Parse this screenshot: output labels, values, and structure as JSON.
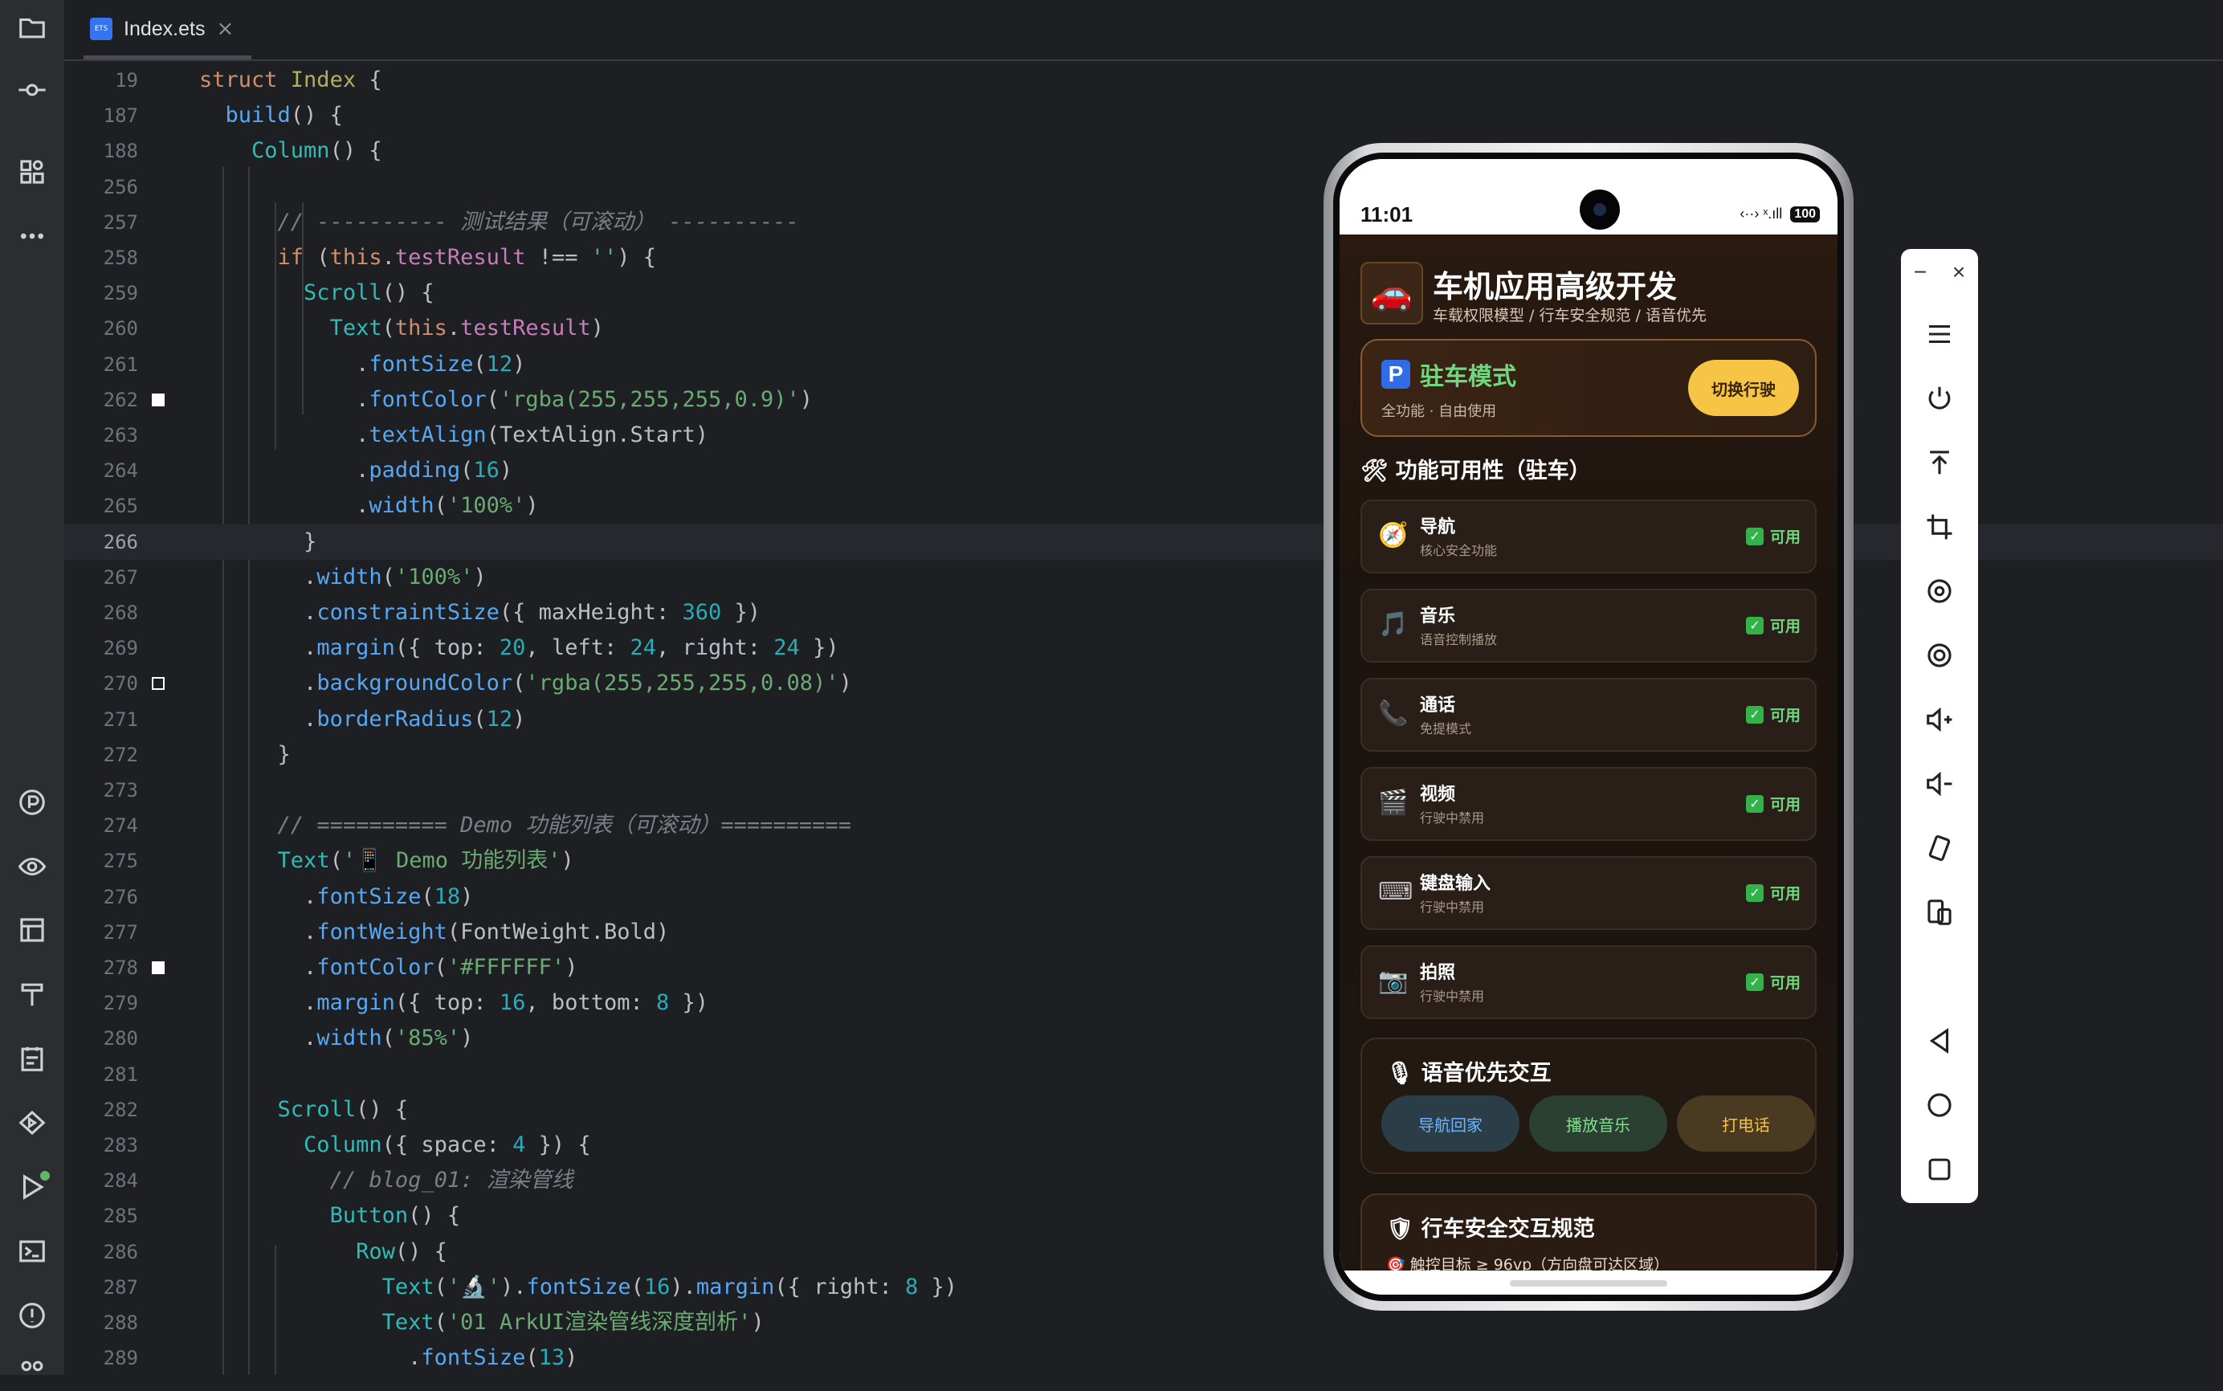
{
  "editor": {
    "tab": {
      "filename": "Index.ets",
      "icon": "ets-file-icon",
      "close": "×"
    },
    "lines": [
      {
        "n": "19",
        "tokens": [
          [
            "kw",
            "struct "
          ],
          [
            "type",
            "Index "
          ],
          [
            "",
            "{"
          ]
        ]
      },
      {
        "n": "187",
        "tokens": [
          [
            "",
            "  "
          ],
          [
            "fn",
            "build"
          ],
          [
            "",
            "() {"
          ]
        ]
      },
      {
        "n": "188",
        "tokens": [
          [
            "",
            "    "
          ],
          [
            "comp",
            "Column"
          ],
          [
            "",
            "() {"
          ]
        ]
      },
      {
        "n": "256",
        "tokens": []
      },
      {
        "n": "257",
        "tokens": [
          [
            "",
            "      "
          ],
          [
            "cmt",
            "// ---------- 测试结果（可滚动） ----------"
          ]
        ]
      },
      {
        "n": "258",
        "tokens": [
          [
            "",
            "      "
          ],
          [
            "kw",
            "if "
          ],
          [
            "",
            "("
          ],
          [
            "this",
            "this"
          ],
          [
            "",
            "."
          ],
          [
            "prop",
            "testResult"
          ],
          [
            "",
            " !== "
          ],
          [
            "str",
            "''"
          ],
          [
            "",
            ") {"
          ]
        ]
      },
      {
        "n": "259",
        "tokens": [
          [
            "",
            "        "
          ],
          [
            "comp",
            "Scroll"
          ],
          [
            "",
            "() {"
          ]
        ]
      },
      {
        "n": "260",
        "tokens": [
          [
            "",
            "          "
          ],
          [
            "comp",
            "Text"
          ],
          [
            "",
            "("
          ],
          [
            "this",
            "this"
          ],
          [
            "",
            "."
          ],
          [
            "prop",
            "testResult"
          ],
          [
            "",
            ")"
          ]
        ]
      },
      {
        "n": "261",
        "tokens": [
          [
            "",
            "            ."
          ],
          [
            "fn",
            "fontSize"
          ],
          [
            "",
            "("
          ],
          [
            "num",
            "12"
          ],
          [
            "",
            ")"
          ]
        ]
      },
      {
        "n": "262",
        "tokens": [
          [
            "",
            "            ."
          ],
          [
            "fn",
            "fontColor"
          ],
          [
            "",
            "("
          ],
          [
            "str",
            "'rgba(255,255,255,0.9)'"
          ],
          [
            "",
            ")"
          ]
        ]
      },
      {
        "n": "263",
        "tokens": [
          [
            "",
            "            ."
          ],
          [
            "fn",
            "textAlign"
          ],
          [
            "",
            "(TextAlign.Start)"
          ]
        ]
      },
      {
        "n": "264",
        "tokens": [
          [
            "",
            "            ."
          ],
          [
            "fn",
            "padding"
          ],
          [
            "",
            "("
          ],
          [
            "num",
            "16"
          ],
          [
            "",
            ")"
          ]
        ]
      },
      {
        "n": "265",
        "tokens": [
          [
            "",
            "            ."
          ],
          [
            "fn",
            "width"
          ],
          [
            "",
            "("
          ],
          [
            "str",
            "'100%'"
          ],
          [
            "",
            ")"
          ]
        ]
      },
      {
        "n": "266",
        "tokens": [
          [
            "",
            "        }"
          ]
        ]
      },
      {
        "n": "267",
        "tokens": [
          [
            "",
            "        ."
          ],
          [
            "fn",
            "width"
          ],
          [
            "",
            "("
          ],
          [
            "str",
            "'100%'"
          ],
          [
            "",
            ")"
          ]
        ]
      },
      {
        "n": "268",
        "tokens": [
          [
            "",
            "        ."
          ],
          [
            "fn",
            "constraintSize"
          ],
          [
            "",
            "({ maxHeight: "
          ],
          [
            "num",
            "360"
          ],
          [
            "",
            " })"
          ]
        ]
      },
      {
        "n": "269",
        "tokens": [
          [
            "",
            "        ."
          ],
          [
            "fn",
            "margin"
          ],
          [
            "",
            "({ top: "
          ],
          [
            "num",
            "20"
          ],
          [
            "",
            ", left: "
          ],
          [
            "num",
            "24"
          ],
          [
            "",
            ", right: "
          ],
          [
            "num",
            "24"
          ],
          [
            "",
            " })"
          ]
        ]
      },
      {
        "n": "270",
        "tokens": [
          [
            "",
            "        ."
          ],
          [
            "fn",
            "backgroundColor"
          ],
          [
            "",
            "("
          ],
          [
            "str",
            "'rgba(255,255,255,0.08)'"
          ],
          [
            "",
            ")"
          ]
        ]
      },
      {
        "n": "271",
        "tokens": [
          [
            "",
            "        ."
          ],
          [
            "fn",
            "borderRadius"
          ],
          [
            "",
            "("
          ],
          [
            "num",
            "12"
          ],
          [
            "",
            ")"
          ]
        ]
      },
      {
        "n": "272",
        "tokens": [
          [
            "",
            "      }"
          ]
        ]
      },
      {
        "n": "273",
        "tokens": []
      },
      {
        "n": "274",
        "tokens": [
          [
            "",
            "      "
          ],
          [
            "cmt",
            "// ========== Demo 功能列表（可滚动）=========="
          ]
        ]
      },
      {
        "n": "275",
        "tokens": [
          [
            "",
            "      "
          ],
          [
            "comp",
            "Text"
          ],
          [
            "",
            "("
          ],
          [
            "str",
            "'📱 Demo 功能列表'"
          ],
          [
            "",
            ")"
          ]
        ]
      },
      {
        "n": "276",
        "tokens": [
          [
            "",
            "        ."
          ],
          [
            "fn",
            "fontSize"
          ],
          [
            "",
            "("
          ],
          [
            "num",
            "18"
          ],
          [
            "",
            ")"
          ]
        ]
      },
      {
        "n": "277",
        "tokens": [
          [
            "",
            "        ."
          ],
          [
            "fn",
            "fontWeight"
          ],
          [
            "",
            "(FontWeight.Bold)"
          ]
        ]
      },
      {
        "n": "278",
        "tokens": [
          [
            "",
            "        ."
          ],
          [
            "fn",
            "fontColor"
          ],
          [
            "",
            "("
          ],
          [
            "str",
            "'#FFFFFF'"
          ],
          [
            "",
            ")"
          ]
        ]
      },
      {
        "n": "279",
        "tokens": [
          [
            "",
            "        ."
          ],
          [
            "fn",
            "margin"
          ],
          [
            "",
            "({ top: "
          ],
          [
            "num",
            "16"
          ],
          [
            "",
            ", bottom: "
          ],
          [
            "num",
            "8"
          ],
          [
            "",
            " })"
          ]
        ]
      },
      {
        "n": "280",
        "tokens": [
          [
            "",
            "        ."
          ],
          [
            "fn",
            "width"
          ],
          [
            "",
            "("
          ],
          [
            "str",
            "'85%'"
          ],
          [
            "",
            ")"
          ]
        ]
      },
      {
        "n": "281",
        "tokens": []
      },
      {
        "n": "282",
        "tokens": [
          [
            "",
            "      "
          ],
          [
            "comp",
            "Scroll"
          ],
          [
            "",
            "() {"
          ]
        ]
      },
      {
        "n": "283",
        "tokens": [
          [
            "",
            "        "
          ],
          [
            "comp",
            "Column"
          ],
          [
            "",
            "({ space: "
          ],
          [
            "num",
            "4"
          ],
          [
            "",
            " }) {"
          ]
        ]
      },
      {
        "n": "284",
        "tokens": [
          [
            "",
            "          "
          ],
          [
            "cmt",
            "// blog_01: 渲染管线"
          ]
        ]
      },
      {
        "n": "285",
        "tokens": [
          [
            "",
            "          "
          ],
          [
            "comp",
            "Button"
          ],
          [
            "",
            "() {"
          ]
        ]
      },
      {
        "n": "286",
        "tokens": [
          [
            "",
            "            "
          ],
          [
            "comp",
            "Row"
          ],
          [
            "",
            "() {"
          ]
        ]
      },
      {
        "n": "287",
        "tokens": [
          [
            "",
            "              "
          ],
          [
            "comp",
            "Text"
          ],
          [
            "",
            "("
          ],
          [
            "str",
            "'🔬'"
          ],
          [
            "",
            ")."
          ],
          [
            "fn",
            "fontSize"
          ],
          [
            "",
            "("
          ],
          [
            "num",
            "16"
          ],
          [
            "",
            ")."
          ],
          [
            "fn",
            "margin"
          ],
          [
            "",
            "({ right: "
          ],
          [
            "num",
            "8"
          ],
          [
            "",
            " })"
          ]
        ]
      },
      {
        "n": "288",
        "tokens": [
          [
            "",
            "              "
          ],
          [
            "comp",
            "Text"
          ],
          [
            "",
            "("
          ],
          [
            "str",
            "'01 ArkUI渲染管线深度剖析'"
          ],
          [
            "",
            ")"
          ]
        ]
      },
      {
        "n": "289",
        "tokens": [
          [
            "",
            "                ."
          ],
          [
            "fn",
            "fontSize"
          ],
          [
            "",
            "("
          ],
          [
            "num",
            "13"
          ],
          [
            "",
            ")"
          ]
        ]
      }
    ],
    "markers": {
      "262": "fill",
      "270": "outline",
      "278": "fill"
    },
    "current_line": "266"
  },
  "phone": {
    "status": {
      "time": "11:01",
      "signal": "‹··› ˣ.ıll",
      "battery": "100"
    },
    "app": {
      "badge_icon": "🚗",
      "title": "车机应用高级开发",
      "subtitle": "车载权限模型 / 行车安全规范 / 语音优先",
      "mode": {
        "badge": "P",
        "title": "驻车模式",
        "sub": "全功能 · 自由使用",
        "button": "切换行驶"
      },
      "features_heading": "🛠 功能可用性（驻车）",
      "features": [
        {
          "icon": "🧭",
          "name": "导航",
          "desc": "核心安全功能",
          "status": "可用"
        },
        {
          "icon": "🎵",
          "name": "音乐",
          "desc": "语音控制播放",
          "status": "可用"
        },
        {
          "icon": "📞",
          "name": "通话",
          "desc": "免提模式",
          "status": "可用"
        },
        {
          "icon": "🎬",
          "name": "视频",
          "desc": "行驶中禁用",
          "status": "可用"
        },
        {
          "icon": "⌨",
          "name": "键盘输入",
          "desc": "行驶中禁用",
          "status": "可用"
        },
        {
          "icon": "📷",
          "name": "拍照",
          "desc": "行驶中禁用",
          "status": "可用"
        }
      ],
      "voice": {
        "title": "🎙 语音优先交互",
        "buttons": [
          "导航回家",
          "播放音乐",
          "打电话"
        ]
      },
      "safety": {
        "title": "🛡 行车安全交互规范",
        "item": "🎯 触控目标 ≥ 96vp（方向盘可达区域）"
      }
    }
  },
  "emulator_tools": {
    "minimize": "−",
    "close": "×"
  },
  "colors": {
    "editor_bg": "#1e1f22",
    "accent_green": "#6fd87e",
    "accent_yellow": "#f6c545",
    "parking_blue": "#2f6ce5"
  }
}
